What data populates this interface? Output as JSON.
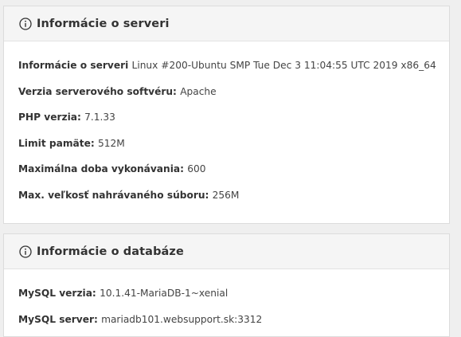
{
  "server_panel": {
    "title": "Informácie o serveri",
    "rows": [
      {
        "label": "Informácie o serveri",
        "value": "Linux #200-Ubuntu SMP Tue Dec 3 11:04:55 UTC 2019 x86_64"
      },
      {
        "label": "Verzia serverového softvéru:",
        "value": "Apache"
      },
      {
        "label": "PHP verzia:",
        "value": "7.1.33"
      },
      {
        "label": "Limit pamäte:",
        "value": "512M"
      },
      {
        "label": "Maximálna doba vykonávania:",
        "value": "600"
      },
      {
        "label": "Max. veľkosť nahrávaného súboru:",
        "value": "256M"
      }
    ]
  },
  "database_panel": {
    "title": "Informácie o databáze",
    "rows": [
      {
        "label": "MySQL verzia:",
        "value": "10.1.41-MariaDB-1~xenial"
      },
      {
        "label": "MySQL server:",
        "value": "mariadb101.websupport.sk:3312"
      }
    ]
  },
  "icons": {
    "panel_header_icon": "info-circle-icon"
  },
  "colors": {
    "page_background": "#efefef",
    "panel_background": "#ffffff",
    "header_background": "#f5f5f5",
    "text": "#333333"
  }
}
